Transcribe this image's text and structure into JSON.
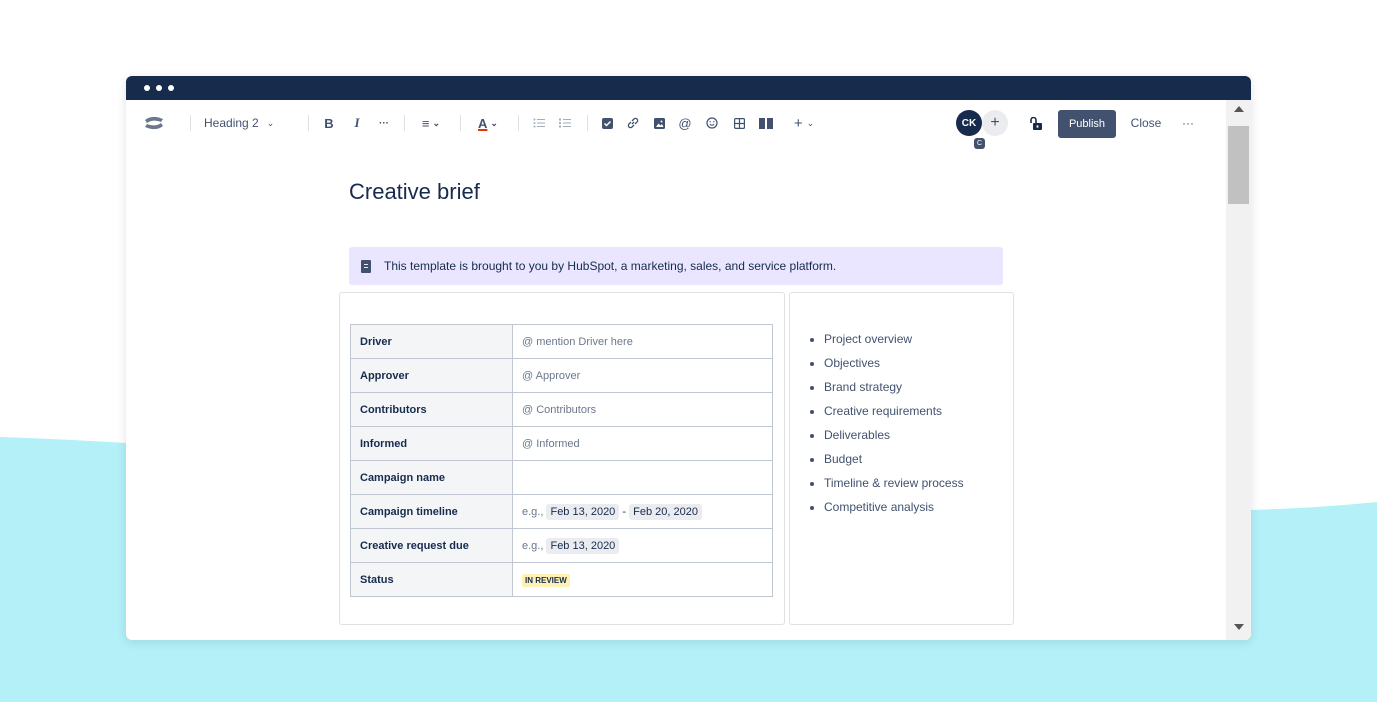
{
  "toolbar": {
    "style_select": "Heading 2",
    "bold": "B",
    "italic": "I",
    "more_format": "···",
    "align": "≡",
    "text_color": "A",
    "chevron": "⌄",
    "insert_more": "+",
    "avatar_initials": "CK",
    "avatar_badge": "C",
    "add_user": "+",
    "publish_label": "Publish",
    "close_label": "Close",
    "more_label": "···"
  },
  "page": {
    "title": "Creative brief",
    "info_panel": "This template is brought to you by HubSpot, a marketing, sales, and service platform."
  },
  "brief_table": {
    "rows": [
      {
        "key": "Driver",
        "value": "@ mention Driver here"
      },
      {
        "key": "Approver",
        "value": "@ Approver"
      },
      {
        "key": "Contributors",
        "value": "@ Contributors"
      },
      {
        "key": "Informed",
        "value": "@ Informed"
      },
      {
        "key": "Campaign name",
        "value": ""
      },
      {
        "key": "Campaign timeline",
        "prefix": "e.g.,",
        "date_start": "Feb 13, 2020",
        "dash": "-",
        "date_end": "Feb 20, 2020"
      },
      {
        "key": "Creative request due",
        "prefix": "e.g.,",
        "date": "Feb 13, 2020"
      },
      {
        "key": "Status",
        "status": "IN REVIEW"
      }
    ]
  },
  "toc": {
    "items": [
      "Project overview",
      "Objectives",
      "Brand strategy",
      "Creative requirements",
      "Deliverables",
      "Budget",
      "Timeline & review process",
      "Competitive analysis"
    ]
  },
  "colors": {
    "titlebar": "#172b4d",
    "background_wave": "#b3f0f7",
    "publish_button": "#42526e",
    "info_panel": "#eae6ff",
    "status_badge": "#fff0b3"
  }
}
